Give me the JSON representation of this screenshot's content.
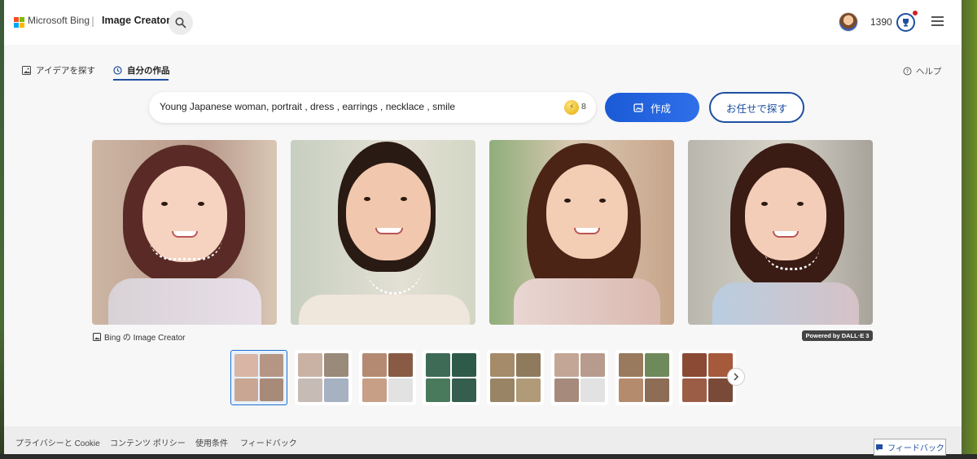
{
  "header": {
    "brand": "Microsoft Bing",
    "separator": "|",
    "product": "Image Creator",
    "points": "1390"
  },
  "tabs": [
    {
      "label": "アイデアを探す",
      "active": false
    },
    {
      "label": "自分の作品",
      "active": true
    }
  ],
  "help": {
    "label": "ヘルプ"
  },
  "prompt": {
    "value": "Young Japanese woman, portrait , dress , earrings , necklace , smile",
    "boosts": "8"
  },
  "buttons": {
    "create": "作成",
    "surprise": "お任せで探す"
  },
  "credit": {
    "label": "Bing の Image Creator",
    "badge": "Powered by DALL·E 3"
  },
  "footer": {
    "links": [
      "プライバシーと Cookie",
      "コンテンツ ポリシー",
      "使用条件",
      "フィードバック"
    ],
    "feedback_button": "フィードバック"
  },
  "colors": {
    "accent": "#1e4fa0",
    "create_button": "#1a5ad6"
  }
}
